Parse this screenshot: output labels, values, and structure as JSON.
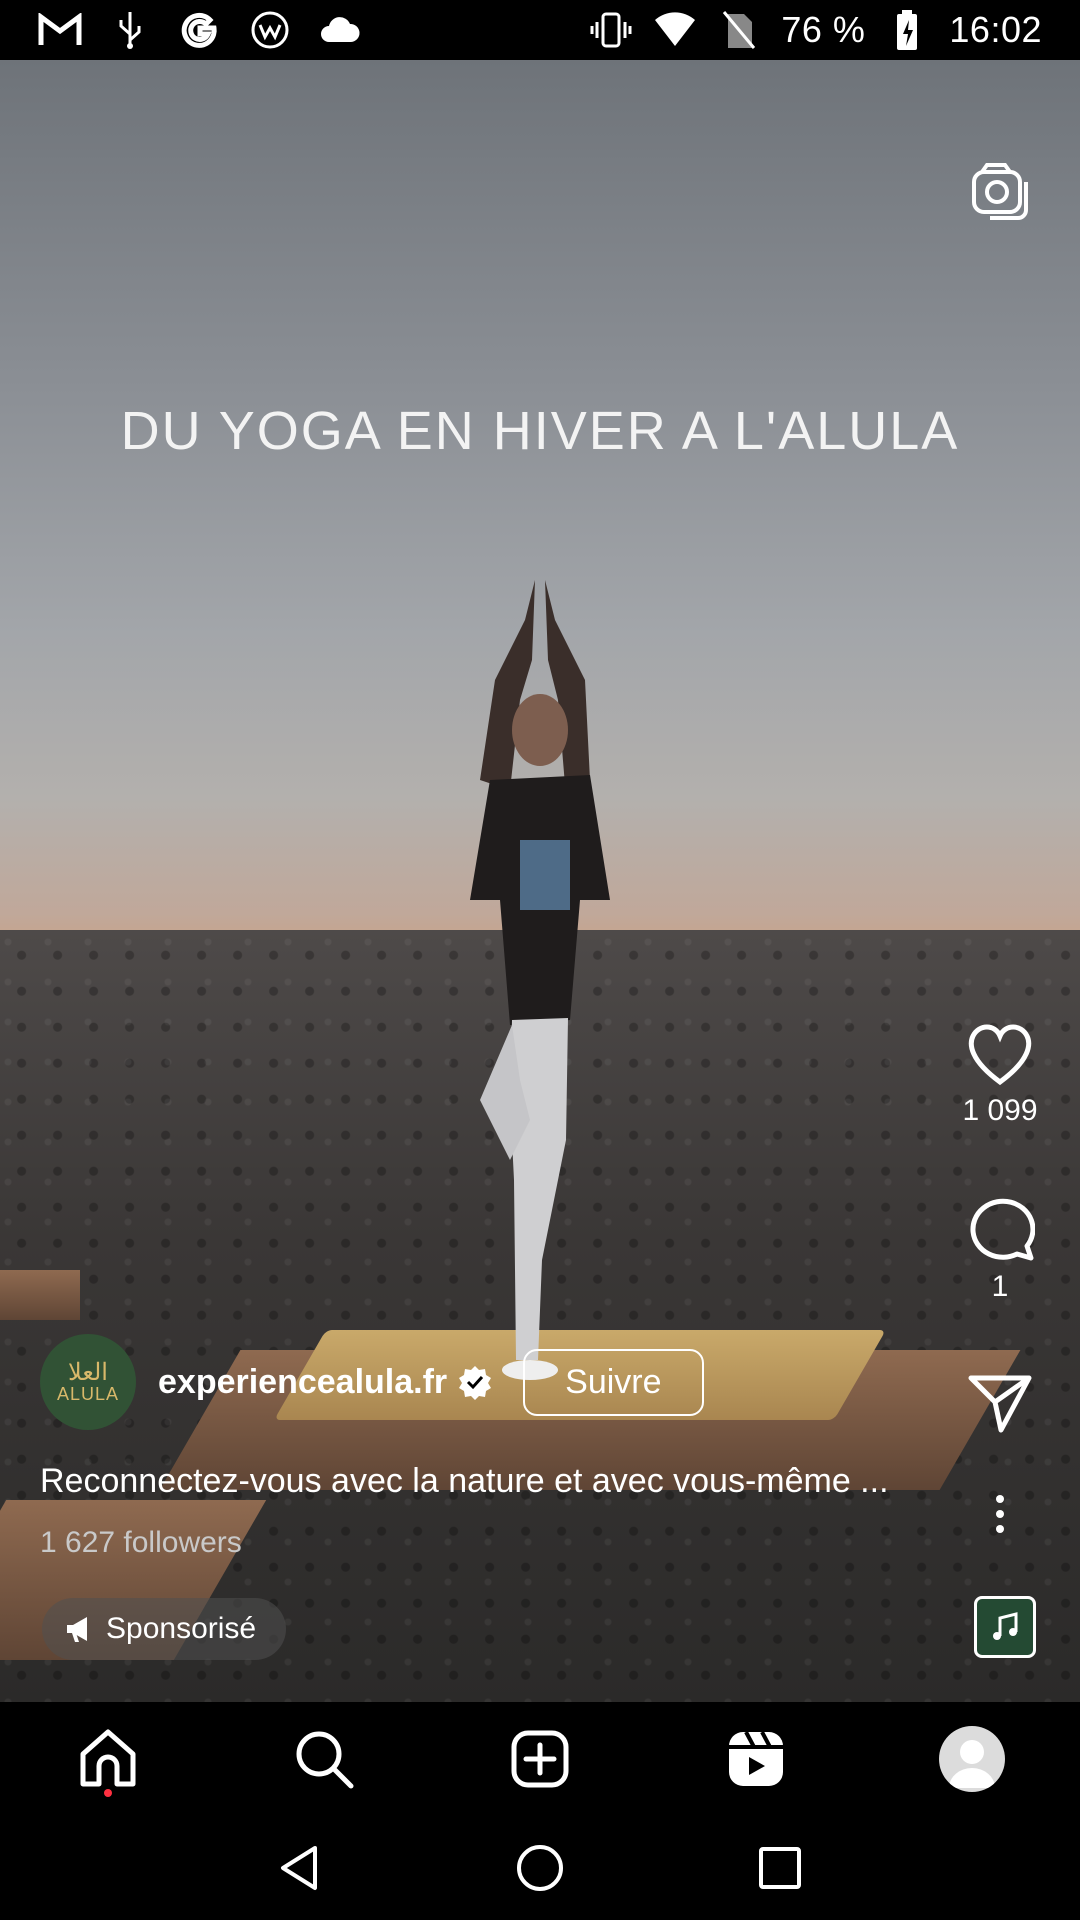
{
  "status_bar": {
    "left_icons": [
      "gmail-icon",
      "usb-icon",
      "google-icon",
      "wear-icon",
      "cloud-icon"
    ],
    "right_icons": [
      "vibrate-icon",
      "wifi-icon",
      "no-sim-icon"
    ],
    "battery": "76 %",
    "time": "16:02"
  },
  "video": {
    "overlay_text": "DU YOGA EN HIVER A L'ALULA"
  },
  "actions": {
    "like_count": "1 099",
    "comment_count": "1"
  },
  "author": {
    "avatar_arabic": "العلا",
    "avatar_latin": "ALULA",
    "username": "experiencealula.fr",
    "follow_label": "Suivre"
  },
  "post": {
    "caption": "Reconnectez-vous avec la nature et avec vous-même ...",
    "followers": "1 627 followers",
    "sponsored_label": "Sponsorisé"
  },
  "bottom_nav": [
    "home-icon",
    "search-icon",
    "create-icon",
    "reels-icon",
    "profile-icon"
  ],
  "colors": {
    "notification_dot": "#ff3040",
    "avatar_bg": "#315235",
    "avatar_text": "#d8b86a"
  }
}
